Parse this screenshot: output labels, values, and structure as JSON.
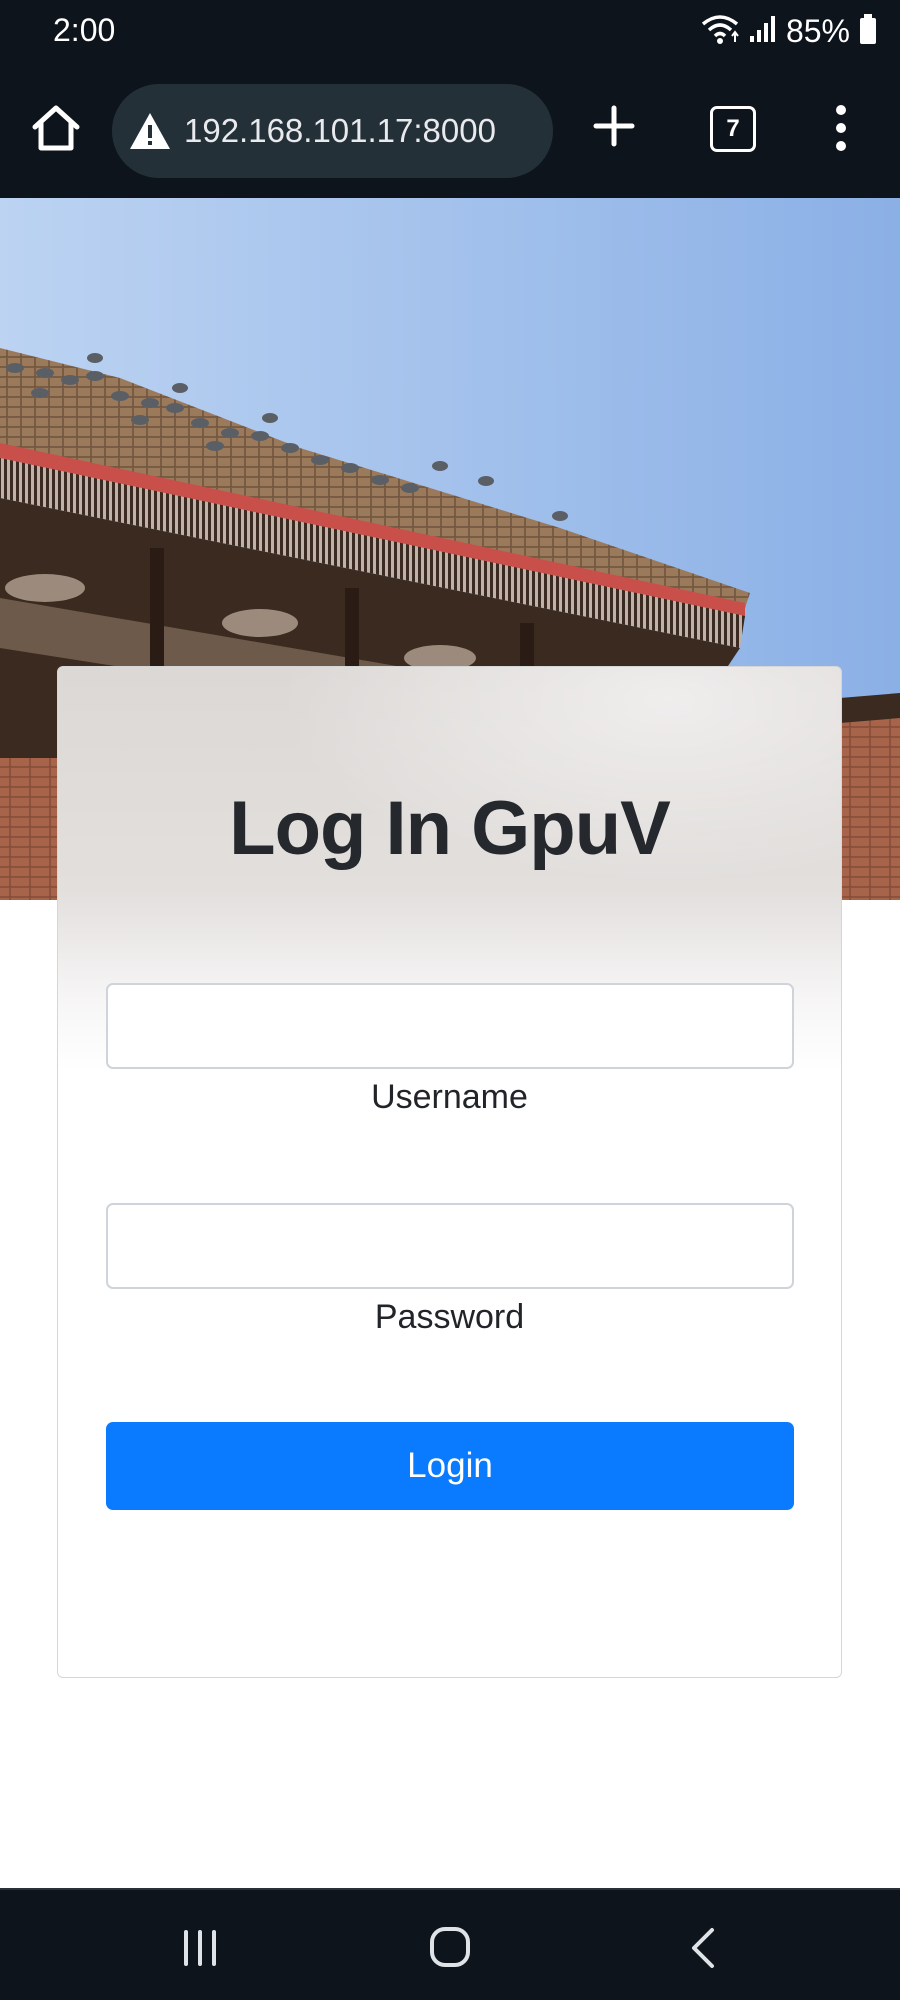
{
  "status_bar": {
    "time": "2:00",
    "battery_percent": "85%",
    "icons": [
      "wifi-icon",
      "signal-icon",
      "battery-icon"
    ]
  },
  "browser": {
    "url": "192.168.101.17:8000",
    "tab_count": "7",
    "icons": [
      "home-icon",
      "warning-icon",
      "plus-icon",
      "tabs-icon",
      "more-vert-icon"
    ]
  },
  "login": {
    "title": "Log In GpuV",
    "username_label": "Username",
    "username_value": "",
    "password_label": "Password",
    "password_value": "",
    "button_label": "Login"
  },
  "nav": {
    "icons": [
      "recent-apps-icon",
      "home-circle-icon",
      "back-icon"
    ]
  },
  "colors": {
    "system_bar": "#0e141b",
    "url_pill": "#243038",
    "primary_button": "#0a7bff",
    "title_text": "#25282d",
    "sky": "#8fb2e3"
  }
}
